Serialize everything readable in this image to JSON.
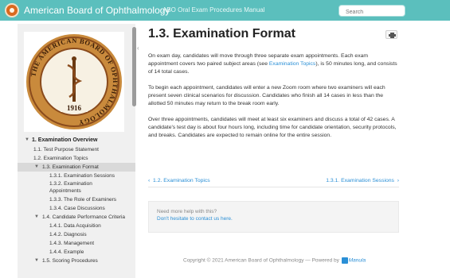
{
  "header": {
    "brand": "American Board of Ophthalmology",
    "manual_title": "ABO Oral Exam Procedures Manual",
    "search_placeholder": "Search"
  },
  "seal": {
    "ring_text": "THE AMERICAN BOARD OF OPHTHALMOLOGY",
    "year": "1916",
    "colors": {
      "outer": "#c98a3c",
      "inner": "#f7f1e3",
      "ring": "#8a4b1c"
    }
  },
  "sidebar": {
    "items": [
      {
        "label": "1. Examination Overview",
        "level": 0,
        "chevron": "chevron-down"
      },
      {
        "label": "1.1. Test Purpose Statement",
        "level": 1
      },
      {
        "label": "1.2. Examination Topics",
        "level": 1
      },
      {
        "label": "1.3. Examination Format",
        "level": 1,
        "chevron": "chevron-down",
        "active": true
      },
      {
        "label": "1.3.1. Examination Sessions",
        "level": 2
      },
      {
        "label": "1.3.2. Examination Appointments",
        "level": 2
      },
      {
        "label": "1.3.3. The Role of Examiners",
        "level": 2
      },
      {
        "label": "1.3.4. Case Discussions",
        "level": 2
      },
      {
        "label": "1.4. Candidate Performance Criteria",
        "level": 1,
        "chevron": "chevron-down"
      },
      {
        "label": "1.4.1. Data Acquisition",
        "level": 2
      },
      {
        "label": "1.4.2. Diagnosis",
        "level": 2
      },
      {
        "label": "1.4.3. Management",
        "level": 2
      },
      {
        "label": "1.4.4. Example",
        "level": 2
      },
      {
        "label": "1.5. Scoring Procedures",
        "level": 1,
        "chevron": "chevron-down"
      }
    ]
  },
  "main": {
    "title": "1.3. Examination Format",
    "p1_before": "On exam day, candidates will move through three separate exam appointments. Each exam appointment covers two paired subject areas (see ",
    "p1_link": "Examination Topics",
    "p1_after": "), is 50 minutes long, and consists of 14 total cases.",
    "p2": "To begin each appointment, candidates will enter a new Zoom room where two examiners will each present seven clinical scenarios for discussion. Candidates who finish all 14 cases in less than the allotted 50 minutes may return to the break room early.",
    "p3": "Over three appointments, candidates will meet at least six examiners and discuss a total of 42 cases. A candidate's test day is about four hours long, including time for candidate orientation, security protocols, and breaks. Candidates are expected to remain online for the entire session.",
    "prev_label": "1.2. Examination Topics",
    "next_label": "1.3.1. Examination Sessions"
  },
  "help": {
    "question": "Need more help with this?",
    "contact": "Don't hesitate to contact us here."
  },
  "footer": {
    "text": "Copyright © 2021 American Board of Ophthalmology — Powered by",
    "brand": "Manula"
  },
  "colors": {
    "topbar": "#5bbfbd",
    "link": "#2a8fd6",
    "sidebar_bg": "#f0f0f0",
    "active_item": "#d9d9d9"
  }
}
